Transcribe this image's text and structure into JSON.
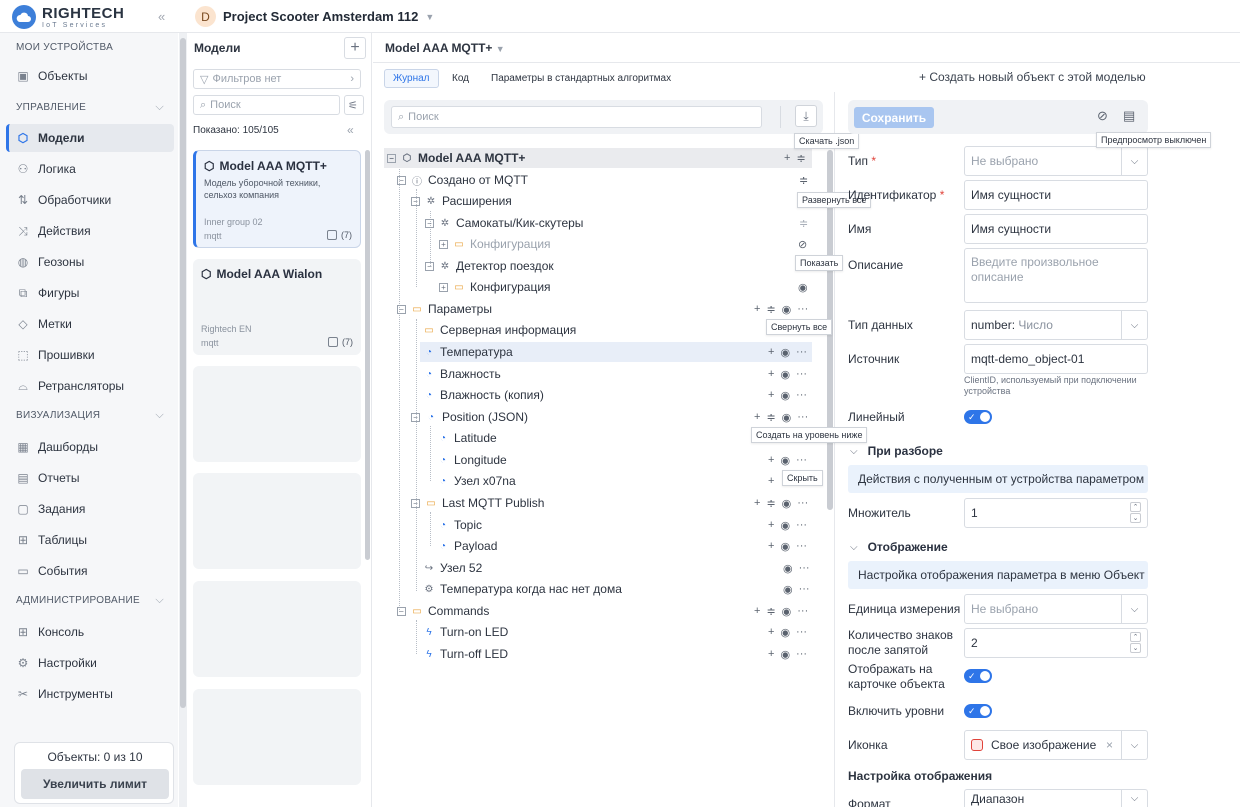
{
  "app": {
    "logo_main": "RIGHTECH",
    "logo_sub": "IoT Services",
    "collapse": "«"
  },
  "project": {
    "avatar": "D",
    "title": "Project Scooter Amsterdam 112"
  },
  "nav": {
    "sections": {
      "my": "МОИ УСТРОЙСТВА",
      "manage": "УПРАВЛЕНИЕ",
      "viz": "ВИЗУАЛИЗАЦИЯ",
      "admin": "АДМИНИСТРИРОВАНИЕ"
    },
    "items": {
      "objects": "Объекты",
      "models": "Модели",
      "logic": "Логика",
      "handlers": "Обработчики",
      "actions": "Действия",
      "geozones": "Геозоны",
      "figures": "Фигуры",
      "marks": "Метки",
      "firmware": "Прошивки",
      "relays": "Ретрансляторы",
      "dashboards": "Дашборды",
      "reports": "Отчеты",
      "tasks": "Задания",
      "tables": "Таблицы",
      "events": "События",
      "console": "Консоль",
      "settings": "Настройки",
      "tools": "Инструменты"
    },
    "limit_text": "Объекты: 0 из 10",
    "limit_button": "Увеличить лимит"
  },
  "models": {
    "title": "Модели",
    "filter_placeholder": "Фильтров нет",
    "search_placeholder": "Поиск",
    "shown": "Показано: 105/105",
    "cards": [
      {
        "title": "Model AAA MQTT+",
        "desc": "Модель уборочной техники, сельхоз компания",
        "group": "Inner group 02",
        "mode": "mqtt",
        "count": "(7)"
      },
      {
        "title": "Model AAA Wialon",
        "desc": "",
        "group": "Rightech EN",
        "mode": "mqtt",
        "count": "(7)"
      }
    ]
  },
  "main": {
    "title": "Model AAA MQTT+",
    "tabs": [
      "Журнал",
      "Код",
      "Параметры в стандартных алгоритмах"
    ],
    "create_new": "+ Создать новый объект с этой моделью"
  },
  "tree": {
    "search_placeholder": "Поиск",
    "nodes": {
      "root": "Model AAA MQTT+",
      "created": "Создано от MQTT",
      "ext": "Расширения",
      "scooters": "Самокаты/Кик-скутеры",
      "config1": "Конфигурация",
      "detector": "Детектор поездок",
      "config2": "Конфигурация",
      "params": "Параметры",
      "server": "Серверная информация",
      "temp": "Температура",
      "hum": "Влажность",
      "humcopy": "Влажность (копия)",
      "pos": "Position (JSON)",
      "lat": "Latitude",
      "lon": "Longitude",
      "node7": "Узел x07na",
      "lastmqtt": "Last MQTT Publish",
      "topic": "Topic",
      "payload": "Payload",
      "node52": "Узел 52",
      "tempaway": "Температура когда нас нет дома",
      "commands": "Commands",
      "ledon": "Turn-on LED",
      "ledoff": "Turn-off LED"
    },
    "tooltips": {
      "download": "Скачать .json",
      "expand": "Развернуть все",
      "show": "Показать",
      "collapse": "Свернуть все",
      "create_below": "Создать на уровень ниже",
      "hide": "Скрыть"
    }
  },
  "props": {
    "save": "Сохранить",
    "preview_tip": "Предпросмотр выключен",
    "type_label": "Тип",
    "type_value": "Не выбрано",
    "id_label": "Идентификатор",
    "id_value": "Имя сущности",
    "name_label": "Имя",
    "name_value": "Имя сущности",
    "desc_label": "Описание",
    "desc_placeholder": "Введите произвольное описание",
    "dtype_label": "Тип данных",
    "dtype_value": "number:",
    "dtype_hint": "Число",
    "source_label": "Источник",
    "source_value": "mqtt-demo_object-01",
    "source_hint": "ClientID, используемый при подключении устройства",
    "linear_label": "Линейный",
    "parse_title": "При разборе",
    "parse_box": "Действия с полученным от устройства параметром",
    "mult_label": "Множитель",
    "mult_value": "1",
    "display_title": "Отображение",
    "display_box": "Настройка отображения параметра в меню Объект",
    "unit_label": "Единица измерения",
    "unit_value": "Не выбрано",
    "decimals_label": "Количество знаков после запятой",
    "decimals_value": "2",
    "oncard_label": "Отображать на карточке объекта",
    "levels_label": "Включить уровни",
    "icon_label": "Иконка",
    "icon_value": "Свое изображение",
    "dispset_title": "Настройка отображения",
    "format_label": "Формат",
    "format_value": "Диапазон"
  }
}
